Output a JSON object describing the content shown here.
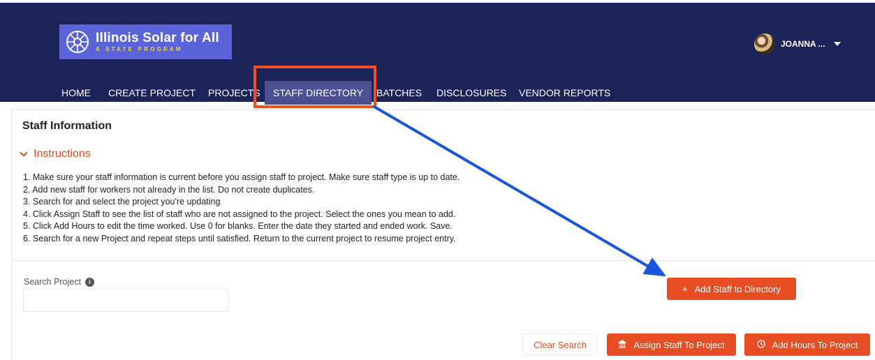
{
  "brand": {
    "title": "Illinois Solar for All",
    "subtitle": "A STATE PROGRAM",
    "logo_icon": "sun-icon"
  },
  "user": {
    "name": "JOANNA ...",
    "menu_icon": "caret-down-icon"
  },
  "nav": {
    "items": [
      {
        "label": "HOME"
      },
      {
        "label": "CREATE PROJECT"
      },
      {
        "label": "PROJECTS"
      },
      {
        "label": "STAFF DIRECTORY",
        "active": true
      },
      {
        "label": "BATCHES"
      },
      {
        "label": "DISCLOSURES"
      },
      {
        "label": "VENDOR REPORTS"
      }
    ]
  },
  "page": {
    "title": "Staff Information",
    "instructions_label": "Instructions",
    "steps": [
      "1. Make sure your staff information is current before you assign staff to project. Make sure staff type is up to date.",
      "2. Add new staff for workers not already in the list. Do not create duplicates.",
      "3. Search for and select the project you're updating",
      "4. Click Assign Staff to see the list of staff who are not assigned to the project. Select the ones you mean to add.",
      "5. Click Add Hours to edit the time worked. Use 0 for blanks. Enter the date they started and ended work. Save.",
      "6. Search for a new Project and repeat steps until satisfied. Return to the current project to resume project entry."
    ]
  },
  "search": {
    "label": "Search Project",
    "value": "",
    "placeholder": ""
  },
  "buttons": {
    "add_staff": "Add Staff to Directory",
    "clear_search": "Clear Search",
    "assign_staff": "Assign Staff To Project",
    "add_hours": "Add Hours To Project"
  },
  "colors": {
    "header_bg": "#1c2359",
    "accent": "#e84c23",
    "annotation_box": "#f04e23",
    "annotation_arrow": "#1a56db"
  }
}
